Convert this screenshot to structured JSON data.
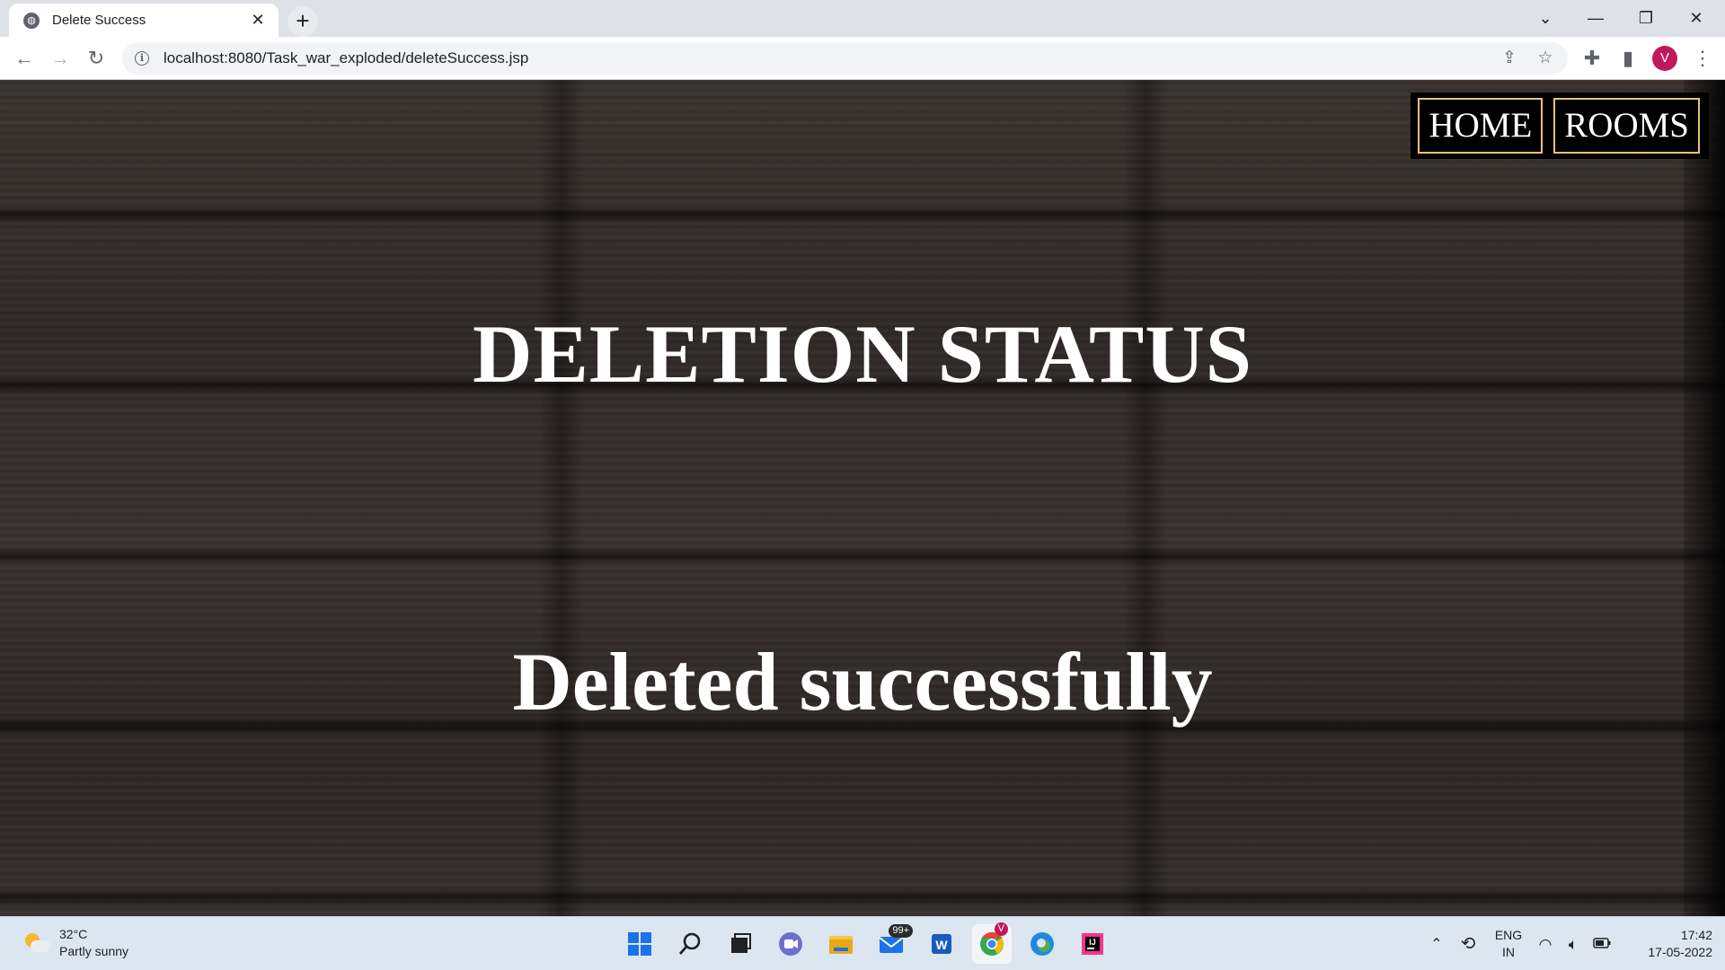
{
  "browser": {
    "tab_title": "Delete Success",
    "url": "localhost:8080/Task_war_exploded/deleteSuccess.jsp",
    "profile_initial": "V"
  },
  "nav": {
    "home_label": "HOME",
    "rooms_label": "ROOMS"
  },
  "content": {
    "heading": "DELETION STATUS",
    "message": "Deleted successfully"
  },
  "taskbar": {
    "temperature": "32°C",
    "weather_desc": "Partly sunny",
    "mail_badge": "99+",
    "chrome_badge": "V",
    "language": "ENG",
    "region": "IN",
    "time": "17:42",
    "date": "17-05-2022"
  },
  "colors": {
    "nav_border": "#e6c47a",
    "nav_bg": "#000000",
    "heading_text": "#ffffff",
    "profile_avatar": "#c2185b"
  },
  "icons": [
    "globe-favicon-icon",
    "close-icon",
    "plus-icon",
    "back-arrow-icon",
    "forward-arrow-icon",
    "reload-icon",
    "info-icon",
    "share-icon",
    "star-icon",
    "extensions-icon",
    "side-panel-icon",
    "more-icon",
    "windows-start-icon",
    "search-icon",
    "task-view-icon",
    "teams-icon",
    "file-explorer-icon",
    "mail-icon",
    "word-icon",
    "chrome-icon",
    "edge-icon",
    "intellij-icon",
    "wifi-icon",
    "volume-icon",
    "battery-icon"
  ]
}
